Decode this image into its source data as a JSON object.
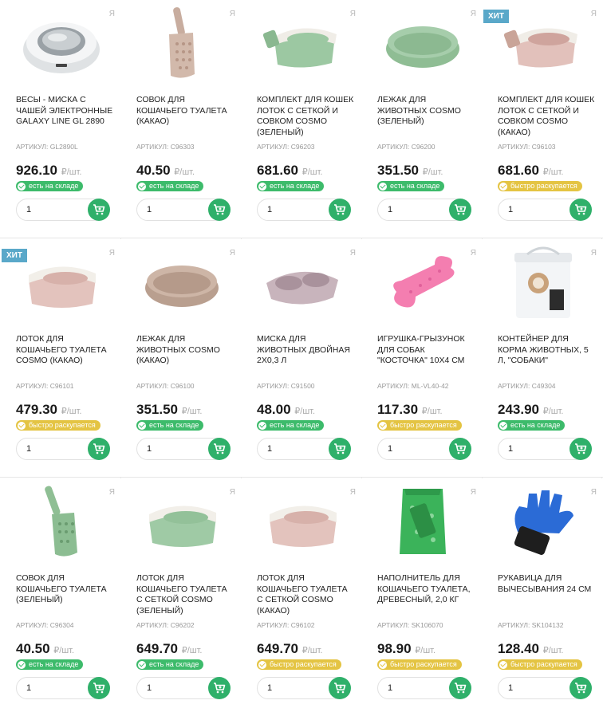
{
  "brand_mark": "Я",
  "labels": {
    "sku_prefix": "АРТИКУЛ:",
    "unit": "₽/шт.",
    "hit": "ХИТ"
  },
  "colors": {
    "in_stock": "#3dbb6b",
    "selling_fast": "#e4c443",
    "cart": "#2fb06a",
    "hit": "#5aa8c9"
  },
  "products": [
    {
      "title": "Весы - миска с чашей электронные Galaxy Line GL 2890",
      "sku": "GL2890L",
      "price": "926.10",
      "status": "есть на складе",
      "status_type": "green",
      "hit": false,
      "qty": "1",
      "icon": "scale-bowl"
    },
    {
      "title": "Совок для кошачьего туалета (какао)",
      "sku": "C96303",
      "price": "40.50",
      "status": "есть на складе",
      "status_type": "green",
      "hit": false,
      "qty": "1",
      "icon": "scoop-cocoa"
    },
    {
      "title": "Комплект для кошек лоток с сеткой и совком Cosmo (зеленый)",
      "sku": "C96203",
      "price": "681.60",
      "status": "есть на складе",
      "status_type": "green",
      "hit": false,
      "qty": "1",
      "icon": "litter-set-green"
    },
    {
      "title": "Лежак для животных Cosmo (зеленый)",
      "sku": "C96200",
      "price": "351.50",
      "status": "есть на складе",
      "status_type": "green",
      "hit": false,
      "qty": "1",
      "icon": "bed-green"
    },
    {
      "title": "Комплект для кошек лоток с сеткой и совком Cosmo (какао)",
      "sku": "C96103",
      "price": "681.60",
      "status": "быстро раскупается",
      "status_type": "yellow",
      "hit": true,
      "qty": "1",
      "icon": "litter-set-cocoa"
    },
    {
      "title": "Лоток для кошачьего туалета Cosmo (какао)",
      "sku": "C96101",
      "price": "479.30",
      "status": "быстро раскупается",
      "status_type": "yellow",
      "hit": true,
      "qty": "1",
      "icon": "litter-box-cocoa"
    },
    {
      "title": "Лежак для животных Cosmo (какао)",
      "sku": "C96100",
      "price": "351.50",
      "status": "есть на складе",
      "status_type": "green",
      "hit": false,
      "qty": "1",
      "icon": "bed-cocoa"
    },
    {
      "title": "Миска для животных двойная 2х0,3 л",
      "sku": "C91500",
      "price": "48.00",
      "status": "есть на складе",
      "status_type": "green",
      "hit": false,
      "qty": "1",
      "icon": "double-bowl"
    },
    {
      "title": "Игрушка-грызунок для собак \"Косточка\" 10х4 см",
      "sku": "ML-VL40-42",
      "price": "117.30",
      "status": "быстро раскупается",
      "status_type": "yellow",
      "hit": false,
      "qty": "1",
      "icon": "bone-toy"
    },
    {
      "title": "Контейнер для корма животных, 5 л, \"Собаки\"",
      "sku": "C49304",
      "price": "243.90",
      "status": "есть на складе",
      "status_type": "green",
      "hit": false,
      "qty": "1",
      "icon": "food-container"
    },
    {
      "title": "Совок для кошачьего туалета (зеленый)",
      "sku": "C96304",
      "price": "40.50",
      "status": "есть на складе",
      "status_type": "green",
      "hit": false,
      "qty": "1",
      "icon": "scoop-green"
    },
    {
      "title": "Лоток для кошачьего туалета с сеткой Cosmo (зеленый)",
      "sku": "C96202",
      "price": "649.70",
      "status": "есть на складе",
      "status_type": "green",
      "hit": false,
      "qty": "1",
      "icon": "litter-box-green"
    },
    {
      "title": "Лоток для кошачьего туалета с сеткой Cosmo (какао)",
      "sku": "C96102",
      "price": "649.70",
      "status": "быстро раскупается",
      "status_type": "yellow",
      "hit": false,
      "qty": "1",
      "icon": "litter-box-cocoa"
    },
    {
      "title": "Наполнитель для кошачьего туалета, древесный, 2,0 кг",
      "sku": "SK106070",
      "price": "98.90",
      "status": "быстро раскупается",
      "status_type": "yellow",
      "hit": false,
      "qty": "1",
      "icon": "litter-bag"
    },
    {
      "title": "Рукавица для вычесывания 24 см",
      "sku": "SK104132",
      "price": "128.40",
      "status": "быстро раскупается",
      "status_type": "yellow",
      "hit": false,
      "qty": "1",
      "icon": "grooming-glove"
    }
  ]
}
